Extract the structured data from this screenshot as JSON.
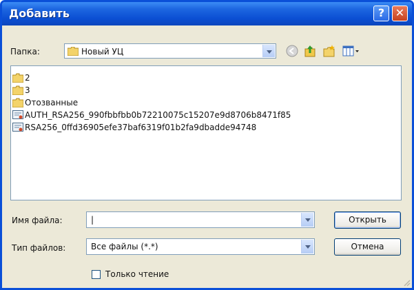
{
  "window": {
    "title": "Добавить",
    "help_glyph": "?",
    "close_glyph": "✕"
  },
  "folder": {
    "label": "Папка:",
    "value": "Новый УЦ"
  },
  "files": [
    {
      "name": "2",
      "icon": "folder-icon"
    },
    {
      "name": "3",
      "icon": "folder-icon"
    },
    {
      "name": "Отозванные",
      "icon": "folder-icon"
    },
    {
      "name": "AUTH_RSA256_990fbbfbb0b72210075c15207e9d8706b8471f85",
      "icon": "certificate-icon"
    },
    {
      "name": "RSA256_0ffd36905efe37baf6319f01b2fa9dbadde94748",
      "icon": "certificate-icon"
    }
  ],
  "filename": {
    "label": "Имя файла:",
    "value": "|"
  },
  "filetype": {
    "label": "Тип файлов:",
    "value": "Все файлы (*.*)"
  },
  "readonly": {
    "label": "Только чтение",
    "checked": false
  },
  "buttons": {
    "open": "Открыть",
    "cancel": "Отмена"
  },
  "colors": {
    "titlebar": "#0b4fd3",
    "dialog_bg": "#ece9d8",
    "input_border": "#7f9db9"
  }
}
